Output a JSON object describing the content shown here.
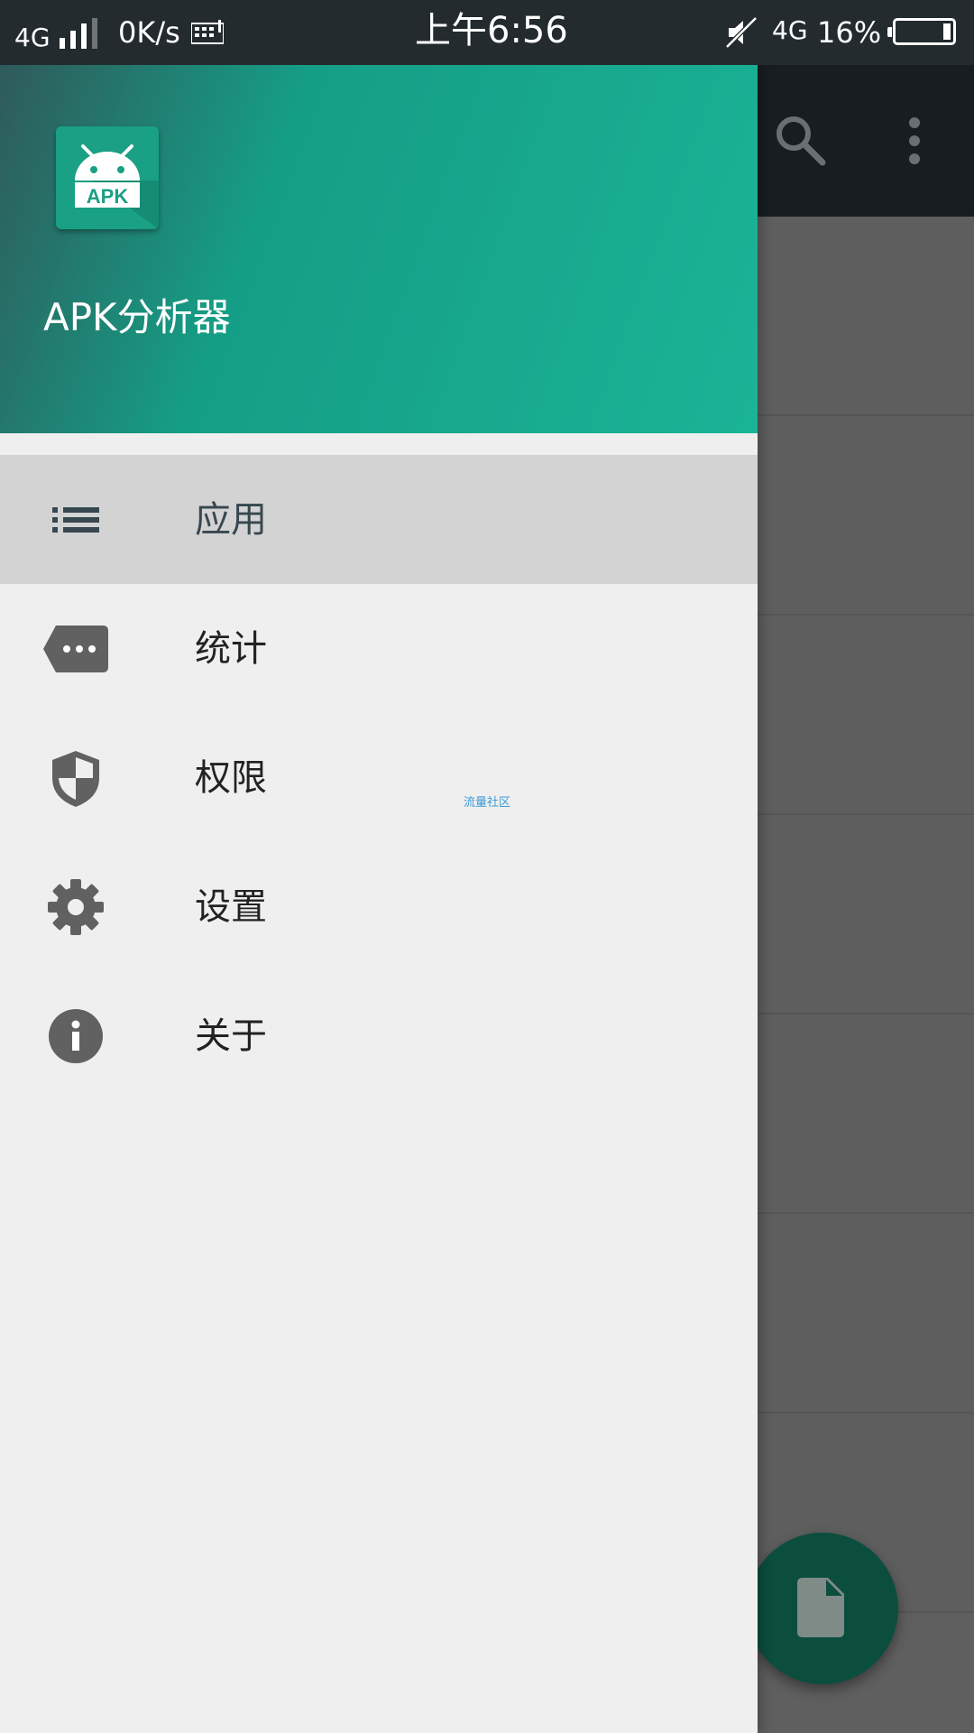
{
  "status_bar": {
    "network_left": "4G",
    "speed": "0K/s",
    "time": "上午6:56",
    "network_right": "4G",
    "battery_percent": "16%",
    "icons": [
      "signal-icon",
      "keyboard-icon",
      "mute-icon",
      "battery-icon"
    ]
  },
  "drawer": {
    "app_title": "APK分析器",
    "app_icon_text": "APK",
    "items": [
      {
        "label": "应用",
        "icon": "list-icon",
        "active": true
      },
      {
        "label": "统计",
        "icon": "label-icon",
        "active": false
      },
      {
        "label": "权限",
        "icon": "shield-icon",
        "active": false
      },
      {
        "label": "设置",
        "icon": "gear-icon",
        "active": false
      },
      {
        "label": "关于",
        "icon": "info-icon",
        "active": false
      }
    ]
  },
  "watermark": "流量社区",
  "colors": {
    "header_start": "#2f5a5a",
    "header_end": "#1ab497",
    "icon_gray": "#616161",
    "active_bg": "#d3d3d3",
    "fab": "#0b4e3e"
  }
}
